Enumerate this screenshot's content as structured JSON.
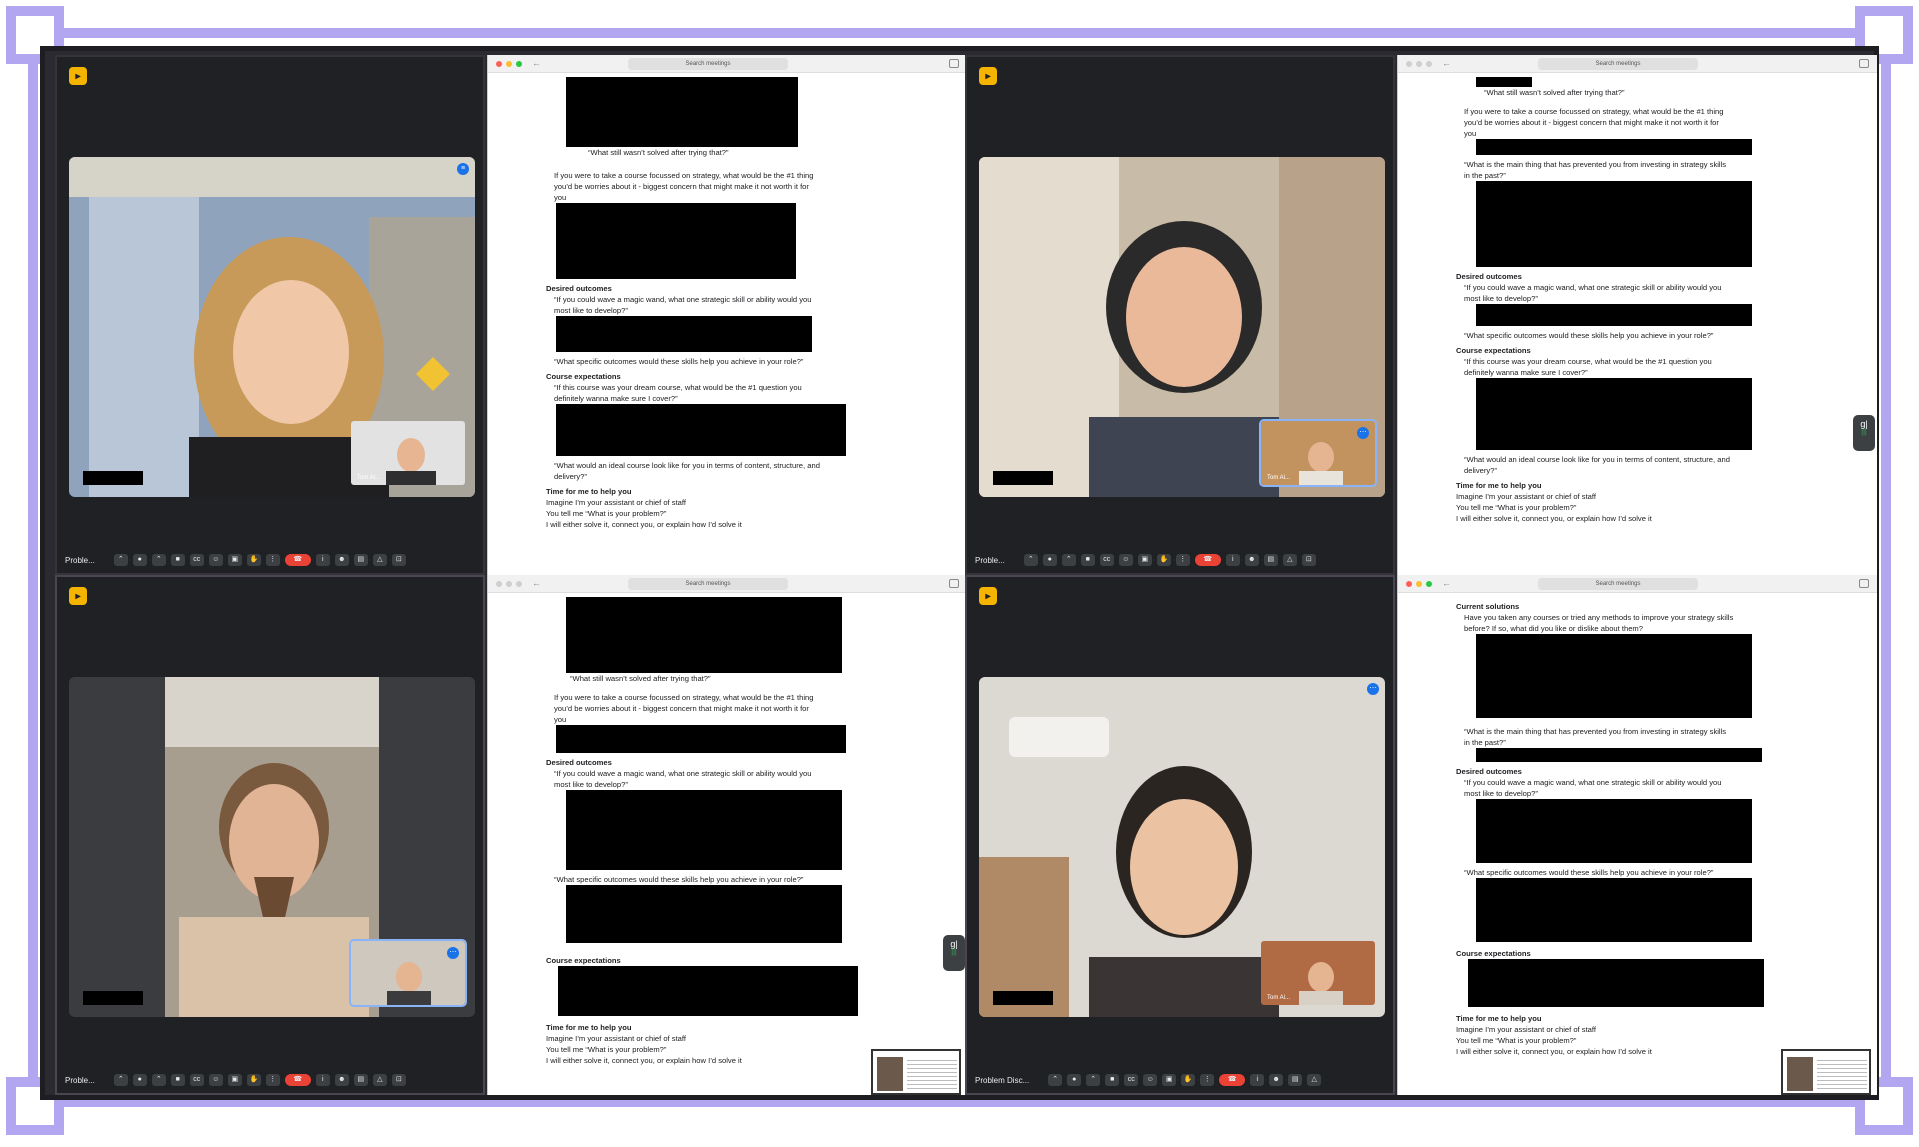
{
  "colors": {
    "frame": "#b3a6f0",
    "meet_bg": "#202124",
    "end_call": "#ea4335",
    "meet_logo": "#f4b400"
  },
  "meet": {
    "meeting_label_short": "Proble...",
    "meeting_label_long": "Problem Disc...",
    "self_name": "Tom Al...",
    "participants_count": "2",
    "controls": [
      "chevron-up-icon",
      "mic-icon",
      "chevron-up-icon",
      "camera-icon",
      "captions-icon",
      "emoji-icon",
      "present-icon",
      "raise-hand-icon",
      "more-icon",
      "end-call-icon",
      "info-icon",
      "people-icon",
      "chat-icon",
      "activities-icon",
      "lock-icon"
    ]
  },
  "doc": {
    "search_placeholder": "Search meetings",
    "q_not_solved": "“What still wasn’t solved after trying that?”",
    "q_course_1": "If you were to take a course focussed on strategy, what would be the #1 thing",
    "q_course_2": "you’d be worries about it - biggest concern that might make it not worth it for",
    "q_course_3": "you",
    "q_skills_tail": "egy skills",
    "h_desired": "Desired outcomes",
    "q_wand_1": "“If you could wave a magic wand, what one strategic skill or ability would you",
    "q_wand_2": "most like to develop?”",
    "q_outcomes": "“What specific outcomes would these skills help you achieve in your role?”",
    "h_course_exp": "Course expectations",
    "q_dream_1": "“If this course was your dream course, what would be the #1 question you",
    "q_dream_2": "definitely wanna make sure I cover?”",
    "q_ideal_1": "“What would an ideal course look like for you in terms of content, structure, and",
    "q_ideal_2": "delivery?”",
    "h_time": "Time for me to help you",
    "l_imagine": "Imagine I’m your assistant or chief of staff",
    "l_tell": "You tell me “What is your problem?”",
    "l_either": "I will either solve it, connect you, or explain how I’d solve it",
    "q_main_1": "“What is the main thing that has prevented you from investing in strategy skills",
    "q_main_2": "in the past?”",
    "h_current": "Current solutions",
    "q_taken_1": "Have you taken any courses or tried any methods to improve your strategy skills",
    "q_taken_2": "before? If so, what did you like or dislike about them?"
  },
  "voice_chip": {
    "glyph": "g|",
    "bars": "|||"
  }
}
